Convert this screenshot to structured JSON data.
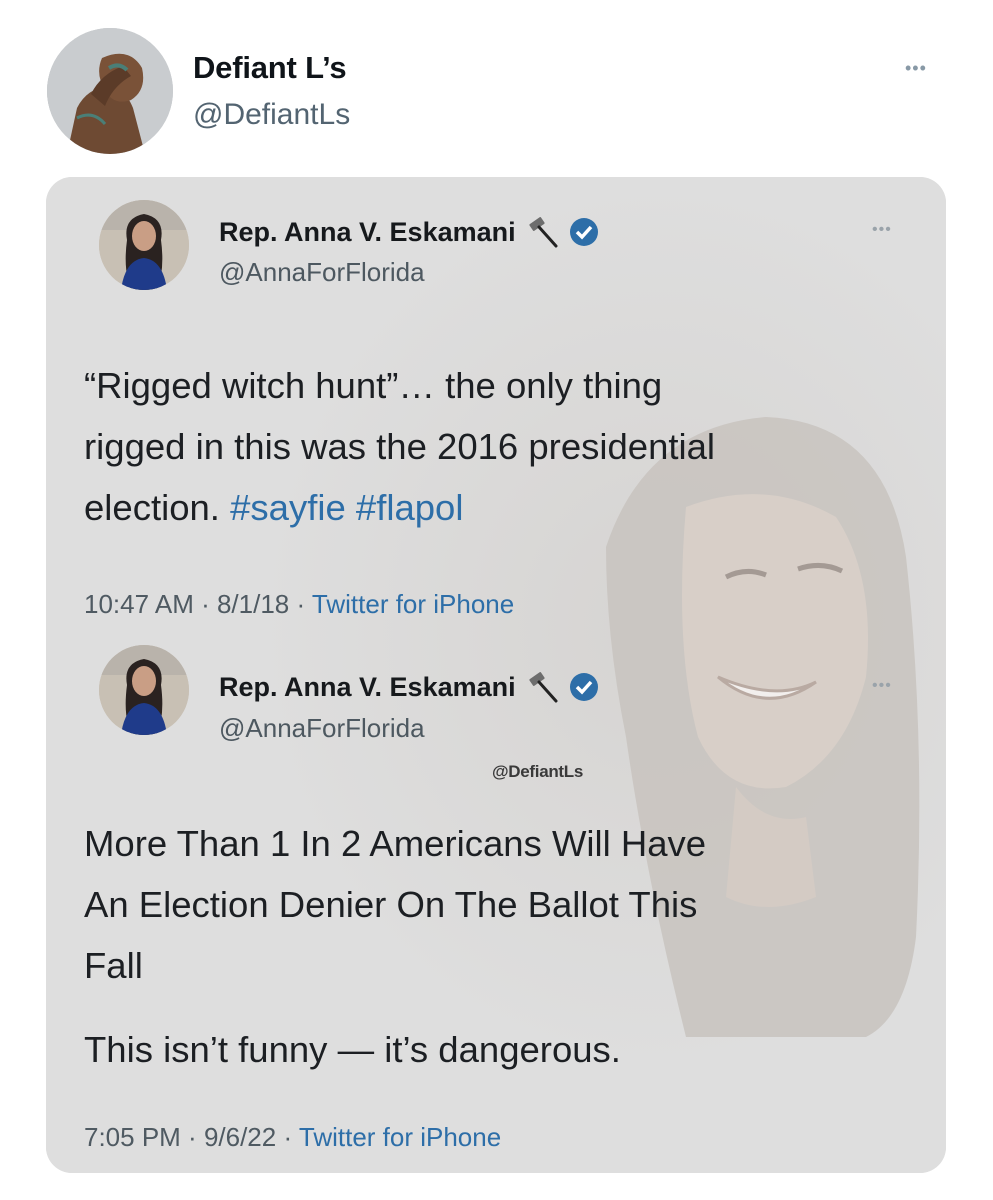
{
  "post": {
    "author_name": "Defiant L’s",
    "author_handle": "@DefiantLs",
    "more_icon": "more-dots-icon"
  },
  "tweets": [
    {
      "name": "Rep. Anna V. Eskamani",
      "handle": "@AnnaForFlorida",
      "icons": [
        "hammer-icon",
        "verified-badge-icon",
        "more-dots-icon"
      ],
      "text_parts": [
        "“Rigged witch hunt”… the only thing",
        "rigged in this was the 2016  presidential",
        "election. "
      ],
      "hashtags": [
        "#sayfie",
        "#flapol"
      ],
      "time": "10:47 AM",
      "date": "8/1/18",
      "source": "Twitter for iPhone"
    },
    {
      "name": "Rep. Anna V. Eskamani",
      "handle": "@AnnaForFlorida",
      "icons": [
        "hammer-icon",
        "verified-badge-icon",
        "more-dots-icon"
      ],
      "text_lines": [
        "More Than 1 In 2 Americans Will Have",
        "An Election Denier On The Ballot This",
        "Fall"
      ],
      "text_2": "This isn’t funny — it’s dangerous.",
      "time": "7:05 PM",
      "date": "9/6/22",
      "source": "Twitter for iPhone"
    }
  ],
  "watermark": "@DefiantLs",
  "separator": " · ",
  "colors": {
    "link": "#2d6ea8",
    "verified": "#1d9bf0",
    "card_bg": "#dedede"
  }
}
